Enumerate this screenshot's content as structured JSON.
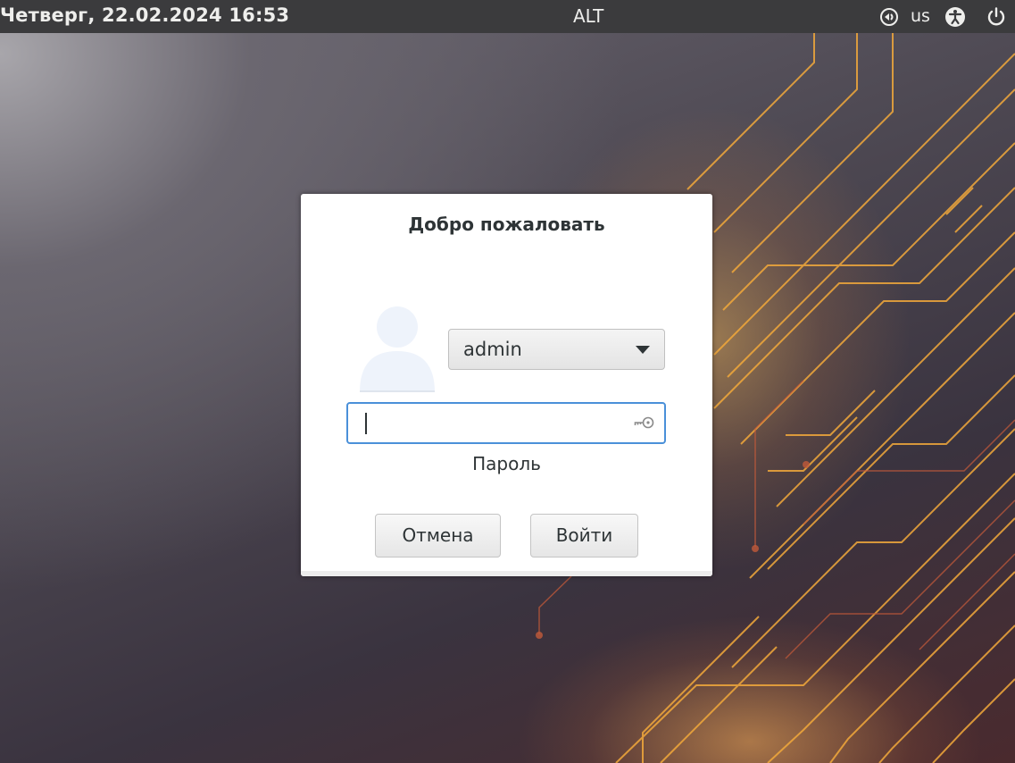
{
  "top_panel": {
    "clock": "Четверг, 22.02.2024 16:53",
    "host": "ALT",
    "keyboard_layout": "us",
    "icons": [
      "display-icon",
      "accessibility-icon",
      "power-icon"
    ]
  },
  "dialog": {
    "title": "Добро пожаловать",
    "user_select": {
      "value": "admin"
    },
    "password": {
      "value": "",
      "label": "Пароль"
    },
    "buttons": {
      "cancel": "Отмена",
      "login": "Войти"
    }
  },
  "colors": {
    "panel": "#3b3b3d",
    "focus_accent": "#4a90d9",
    "wallpaper_line": "#f2a93b"
  }
}
